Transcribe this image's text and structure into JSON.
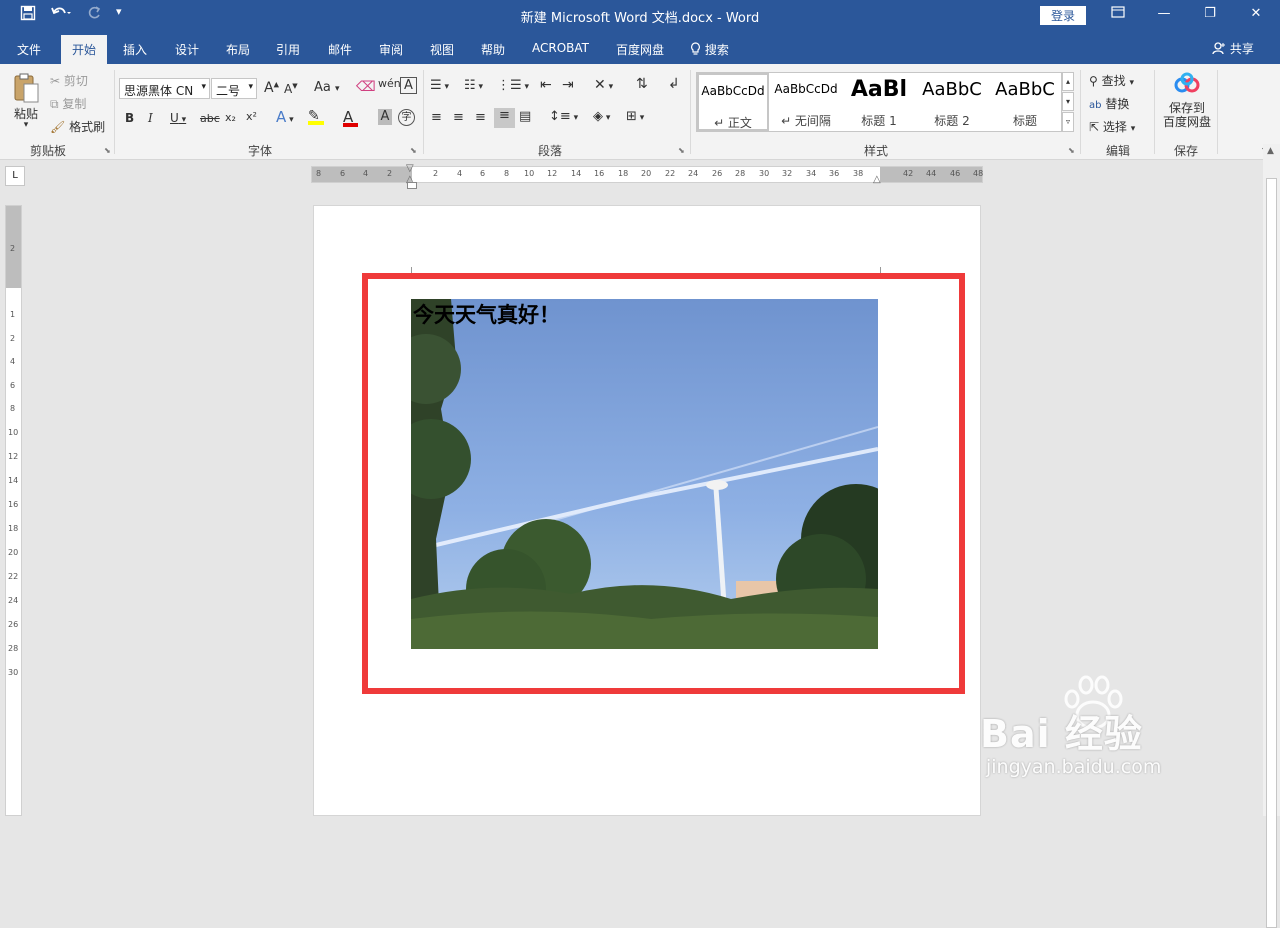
{
  "titlebar": {
    "title": "新建 Microsoft Word 文档.docx  -  Word",
    "login_label": "登录",
    "quick_access": {
      "save": "save-icon",
      "undo": "undo-icon",
      "redo": "redo-icon",
      "customize": "customize-icon"
    }
  },
  "tabs": [
    "文件",
    "开始",
    "插入",
    "设计",
    "布局",
    "引用",
    "邮件",
    "审阅",
    "视图",
    "帮助",
    "ACROBAT",
    "百度网盘",
    "搜索"
  ],
  "active_tab": "开始",
  "share_label": "共享",
  "clipboard": {
    "paste": "粘贴",
    "cut": "剪切",
    "copy": "复制",
    "format_painter": "格式刷",
    "group": "剪贴板"
  },
  "font": {
    "family": "思源黑体 CN",
    "size": "二号",
    "grow": "A",
    "shrink": "A",
    "case": "Aa",
    "bold": "B",
    "italic": "I",
    "underline": "U",
    "strike": "abc",
    "subscript": "x₂",
    "superscript": "x²",
    "group": "字体"
  },
  "paragraph": {
    "group": "段落"
  },
  "styles": {
    "group": "样式",
    "items": [
      {
        "preview": "AaBbCcDd",
        "name": "↵ 正文"
      },
      {
        "preview": "AaBbCcDd",
        "name": "↵ 无间隔"
      },
      {
        "preview": "AaBl",
        "name": "标题 1"
      },
      {
        "preview": "AaBbC",
        "name": "标题 2"
      },
      {
        "preview": "AaBbC",
        "name": "标题"
      }
    ]
  },
  "editing": {
    "find": "查找",
    "replace": "替换",
    "select": "选择",
    "group": "编辑"
  },
  "save": {
    "label_line1": "保存到",
    "label_line2": "百度网盘",
    "group": "保存"
  },
  "ruler": {
    "h_left": [
      "8",
      "6",
      "4",
      "2"
    ],
    "h_right": [
      "2",
      "4",
      "6",
      "8",
      "10",
      "12",
      "14",
      "16",
      "18",
      "20",
      "22",
      "24",
      "26",
      "28",
      "30",
      "32",
      "34",
      "36",
      "38"
    ],
    "h_margin_right": [
      "42",
      "44",
      "46",
      "48"
    ],
    "v_top": [
      "2"
    ],
    "v_marks": [
      "1",
      "2",
      "4",
      "6",
      "8",
      "10",
      "12",
      "14",
      "16",
      "18",
      "20",
      "22",
      "24",
      "26",
      "28",
      "30"
    ]
  },
  "document": {
    "text": "今天天气真好！"
  },
  "watermark": {
    "brand": "Bai  经验",
    "url": "jingyan.baidu.com"
  },
  "colors": {
    "accent": "#2b579a",
    "highlight_border": "#ef3a3a",
    "font_color": "#e00000",
    "highlighter": "#ffff00"
  }
}
